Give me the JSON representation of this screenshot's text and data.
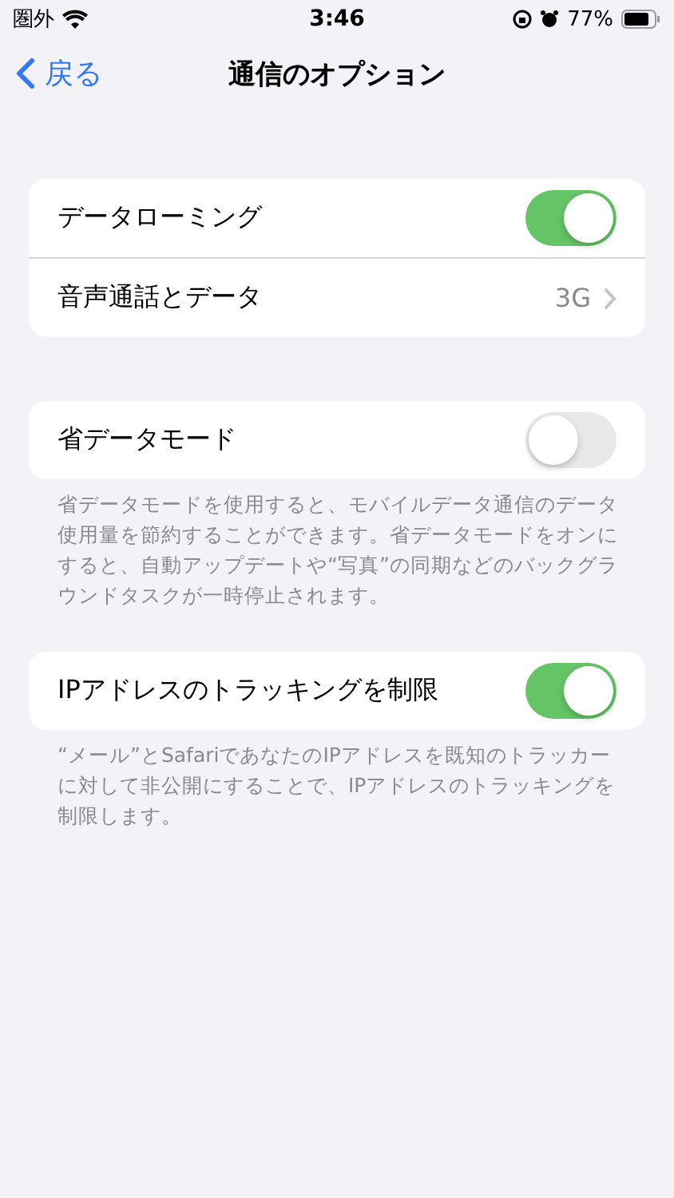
{
  "status_bar": {
    "carrier": "圏外",
    "time": "3:46",
    "battery": "77%"
  },
  "nav": {
    "back": "戻る",
    "title": "通信のオプション"
  },
  "groups": [
    {
      "rows": [
        {
          "kind": "toggle",
          "label": "データローミング",
          "on": true
        },
        {
          "kind": "disclosure",
          "label": "音声通話とデータ",
          "value": "3G"
        }
      ]
    },
    {
      "rows": [
        {
          "kind": "toggle",
          "label": "省データモード",
          "on": false
        }
      ],
      "footer": "省データモードを使用すると、モバイルデータ通信のデータ使用量を節約することができます。省データモードをオンにすると、自動アップデートや“写真”の同期などのバックグラウンドタスクが一時停止されます。"
    },
    {
      "rows": [
        {
          "kind": "toggle",
          "label": "IPアドレスのトラッキングを制限",
          "on": true
        }
      ],
      "footer": "“メール”とSafariであなたのIPアドレスを既知のトラッカーに対して非公開にすることで、IPアドレスのトラッキングを制限します。"
    }
  ]
}
